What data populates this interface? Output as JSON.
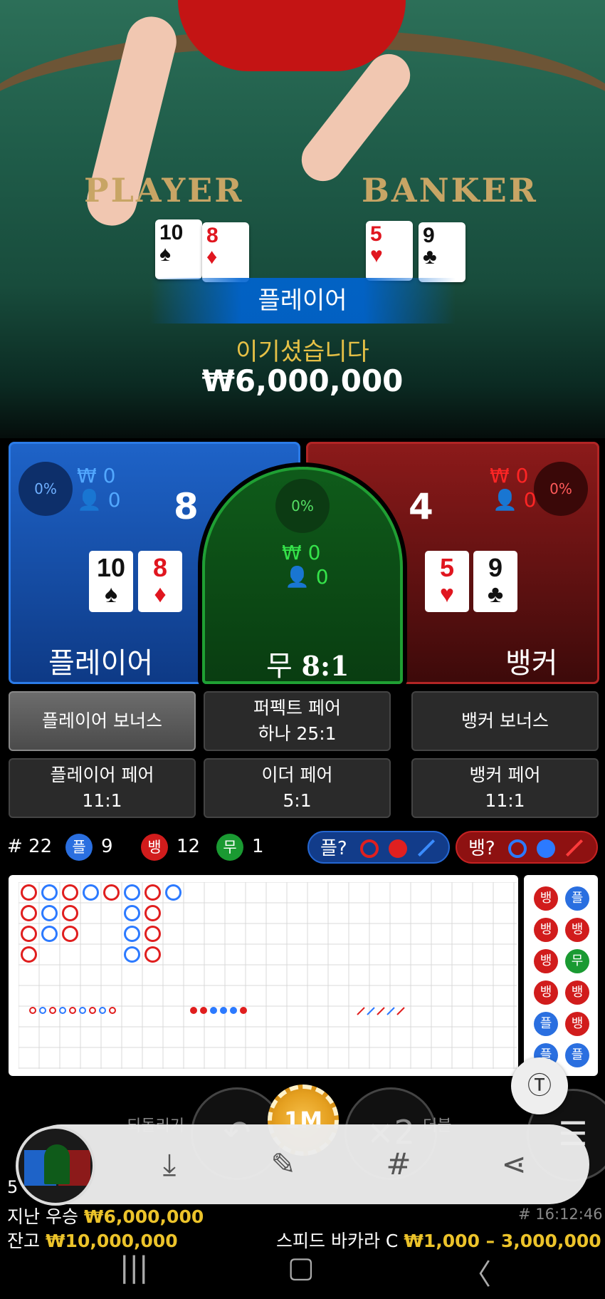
{
  "video": {
    "felt_player": "PLAYER",
    "felt_banker": "BANKER",
    "result_banner": "플레이어",
    "win_label": "이기셨습니다",
    "win_amount": "₩6,000,000",
    "player_cards": [
      {
        "rank": "10",
        "suit": "♠"
      },
      {
        "rank": "8",
        "suit": "♦"
      }
    ],
    "banker_cards": [
      {
        "rank": "5",
        "suit": "♥"
      },
      {
        "rank": "9",
        "suit": "♣"
      }
    ]
  },
  "player_panel": {
    "percent": "0%",
    "amount": "₩ 0",
    "players": "0",
    "score": "8",
    "label": "플레이어",
    "cards": [
      {
        "rank": "10",
        "suit": "♠"
      },
      {
        "rank": "8",
        "suit": "♦"
      }
    ]
  },
  "tie_panel": {
    "percent": "0%",
    "amount": "₩ 0",
    "players": "0",
    "label": "무",
    "odds": "8:1"
  },
  "banker_panel": {
    "percent": "0%",
    "amount": "₩ 0",
    "players": "0",
    "score": "4",
    "label": "뱅커",
    "cards": [
      {
        "rank": "5",
        "suit": "♥"
      },
      {
        "rank": "9",
        "suit": "♣"
      }
    ]
  },
  "side_bets": {
    "player_bonus": "플레이어 보너스",
    "perfect_pair": "퍼펙트 페어",
    "perfect_pair_odds": "하나 25:1",
    "banker_bonus": "뱅커 보너스",
    "player_pair": "플레이어 페어",
    "player_pair_odds": "11:1",
    "either_pair": "이더 페어",
    "either_pair_odds": "5:1",
    "banker_pair": "뱅커 페어",
    "banker_pair_odds": "11:1"
  },
  "stats": {
    "round": "# 22",
    "player_badge": "플",
    "player_count": "9",
    "banker_badge": "뱅",
    "banker_count": "12",
    "tie_badge": "무",
    "tie_count": "1",
    "ask_player": "플?",
    "ask_banker": "뱅?"
  },
  "bead_road": [
    [
      "뱅",
      "플"
    ],
    [
      "뱅",
      "뱅"
    ],
    [
      "뱅",
      "무"
    ],
    [
      "뱅",
      "뱅"
    ],
    [
      "플",
      "뱅"
    ],
    [
      "플",
      "플"
    ]
  ],
  "controls": {
    "undo_label": "되돌리기",
    "double_label": "더블",
    "chip_value": "1M",
    "double_symbol": "×2"
  },
  "footer": {
    "partial_number": "5",
    "last_win_label": "지난 우승",
    "last_win_value": "₩6,000,000",
    "balance_label": "잔고",
    "balance_value": "₩10,000,000",
    "game_id": "# 16:12:46",
    "table_name": "스피드 바카라 C",
    "bet_limit": "₩1,000 – 3,000,000"
  },
  "colors": {
    "player_blue": "#1e63c8",
    "banker_red": "#8c1a1a",
    "tie_green": "#0f5b1a",
    "gold": "#ecc32a"
  }
}
